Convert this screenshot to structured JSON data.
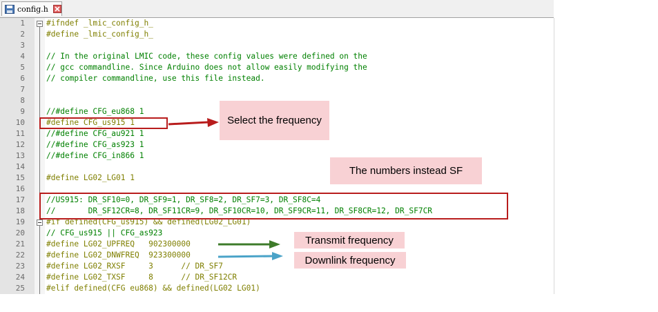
{
  "tab": {
    "filename": "config.h",
    "file_icon": "save-icon",
    "close_icon": "close-icon"
  },
  "lines": [
    {
      "n": "1",
      "text": "#ifndef _lmic_config_h_",
      "kind": "pre"
    },
    {
      "n": "2",
      "text": "#define _lmic_config_h_",
      "kind": "pre"
    },
    {
      "n": "3",
      "text": "",
      "kind": "txt"
    },
    {
      "n": "4",
      "text": "// In the original LMIC code, these config values were defined on the",
      "kind": "cmt"
    },
    {
      "n": "5",
      "text": "// gcc commandline. Since Arduino does not allow easily modifying the",
      "kind": "cmt"
    },
    {
      "n": "6",
      "text": "// compiler commandline, use this file instead.",
      "kind": "cmt"
    },
    {
      "n": "7",
      "text": "",
      "kind": "txt"
    },
    {
      "n": "8",
      "text": "",
      "kind": "txt"
    },
    {
      "n": "9",
      "text": "//#define CFG_eu868 1",
      "kind": "cmt"
    },
    {
      "n": "10",
      "text": "#define CFG_us915 1",
      "kind": "pre"
    },
    {
      "n": "11",
      "text": "//#define CFG_au921 1",
      "kind": "cmt"
    },
    {
      "n": "12",
      "text": "//#define CFG_as923 1",
      "kind": "cmt"
    },
    {
      "n": "13",
      "text": "//#define CFG_in866 1",
      "kind": "cmt"
    },
    {
      "n": "14",
      "text": "",
      "kind": "txt"
    },
    {
      "n": "15",
      "text": "#define LG02_LG01 1",
      "kind": "pre"
    },
    {
      "n": "16",
      "text": "",
      "kind": "txt"
    },
    {
      "n": "17",
      "text": "//US915: DR_SF10=0, DR_SF9=1, DR_SF8=2, DR_SF7=3, DR_SF8C=4",
      "kind": "cmt"
    },
    {
      "n": "18",
      "text": "//       DR_SF12CR=8, DR_SF11CR=9, DR_SF10CR=10, DR_SF9CR=11, DR_SF8CR=12, DR_SF7CR",
      "kind": "cmt"
    },
    {
      "n": "19",
      "text": "#if defined(CFG_us915) && defined(LG02_LG01)",
      "kind": "pre"
    },
    {
      "n": "20",
      "text": "// CFG_us915 || CFG_as923",
      "kind": "cmt"
    },
    {
      "n": "21",
      "text": "#define LG02_UPFREQ   902300000",
      "kind": "pre"
    },
    {
      "n": "22",
      "text": "#define LG02_DNWFREQ  923300000",
      "kind": "pre"
    },
    {
      "n": "23",
      "text": "#define LG02_RXSF     3      // DR_SF7",
      "kind": "pre"
    },
    {
      "n": "24",
      "text": "#define LG02_TXSF     8      // DR_SF12CR",
      "kind": "pre"
    },
    {
      "n": "25",
      "text": "#elif defined(CFG eu868) && defined(LG02 LG01)",
      "kind": "pre"
    }
  ],
  "callouts": {
    "select_frequency": "Select the frequency",
    "numbers_instead_sf": "The numbers instead SF",
    "transmit_frequency": "Transmit frequency",
    "downlink_frequency": "Downlink frequency"
  },
  "colors": {
    "highlight_box": "#b81c1c",
    "callout_bg": "#f8d1d4",
    "arrow_green": "#3e7b2a",
    "arrow_blue": "#4aa3c8"
  }
}
